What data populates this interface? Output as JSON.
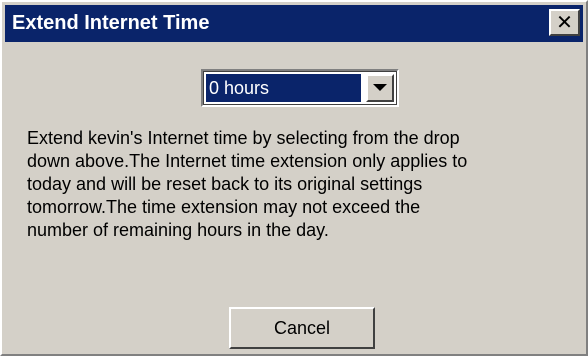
{
  "window": {
    "title": "Extend Internet Time",
    "close_icon": "close-icon"
  },
  "hours_select": {
    "selected_value": "0 hours",
    "arrow_icon": "chevron-down-icon"
  },
  "description": {
    "lines": [
      "Extend kevin's Internet time by selecting from the drop",
      "down above.The Internet time extension only applies to",
      "today and will be reset back to its original settings",
      "tomorrow.The time extension may not exceed the",
      "number of remaining hours in the day."
    ]
  },
  "buttons": {
    "cancel_label": "Cancel"
  },
  "colors": {
    "titlebar": "#0a246a",
    "dialog_face": "#d4d0c8",
    "selection": "#0a246a"
  }
}
